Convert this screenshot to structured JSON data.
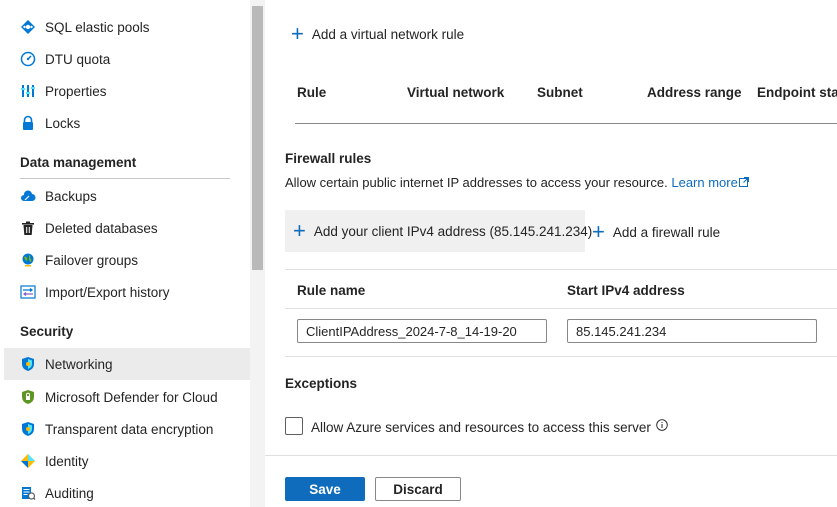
{
  "sidebar": {
    "items_top": [
      {
        "label": "SQL elastic pools",
        "icon": "elastic-pool-icon"
      },
      {
        "label": "DTU quota",
        "icon": "gauge-icon"
      },
      {
        "label": "Properties",
        "icon": "properties-icon"
      },
      {
        "label": "Locks",
        "icon": "lock-icon"
      }
    ],
    "data_management": {
      "header": "Data management",
      "items": [
        {
          "label": "Backups",
          "icon": "cloud-backup-icon"
        },
        {
          "label": "Deleted databases",
          "icon": "trash-icon"
        },
        {
          "label": "Failover groups",
          "icon": "globe-icon"
        },
        {
          "label": "Import/Export history",
          "icon": "import-export-icon"
        }
      ]
    },
    "security": {
      "header": "Security",
      "items": [
        {
          "label": "Networking",
          "icon": "shield-icon",
          "selected": true
        },
        {
          "label": "Microsoft Defender for Cloud",
          "icon": "defender-shield-icon"
        },
        {
          "label": "Transparent data encryption",
          "icon": "shield-icon"
        },
        {
          "label": "Identity",
          "icon": "identity-icon"
        },
        {
          "label": "Auditing",
          "icon": "auditing-icon"
        }
      ]
    }
  },
  "vnet": {
    "add_label": "Add a virtual network rule",
    "columns": [
      "Rule",
      "Virtual network",
      "Subnet",
      "Address range",
      "Endpoint status"
    ]
  },
  "firewall": {
    "title": "Firewall rules",
    "description": "Allow certain public internet IP addresses to access your resource.",
    "learn_more": "Learn more",
    "add_client_label": "Add your client IPv4 address (85.145.241.234)",
    "add_rule_label": "Add a firewall rule",
    "columns": [
      "Rule name",
      "Start IPv4 address"
    ],
    "rows": [
      {
        "rule_name": "ClientIPAddress_2024-7-8_14-19-20",
        "start_ip": "85.145.241.234"
      }
    ]
  },
  "exceptions": {
    "title": "Exceptions",
    "allow_azure_label": "Allow Azure services and resources to access this server",
    "allow_azure_checked": false
  },
  "footer": {
    "save_label": "Save",
    "discard_label": "Discard"
  },
  "colors": {
    "accent": "#0f6cbd",
    "selected_bg": "#ebebeb"
  }
}
